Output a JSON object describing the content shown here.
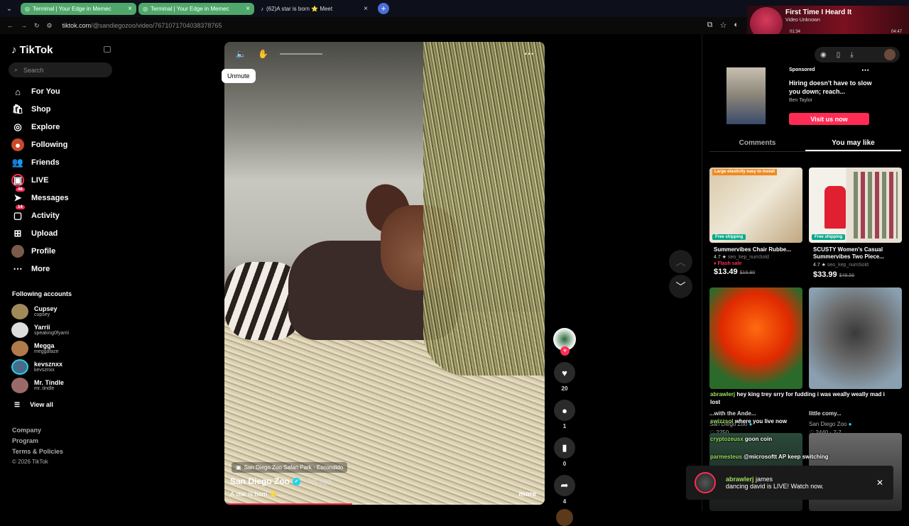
{
  "browser": {
    "tabs": [
      {
        "title": "Terminal | Your Edge in Memec"
      },
      {
        "title": "Terminal | Your Edge in Memec"
      },
      {
        "title": "(62)A star is born ⭐ Meet"
      }
    ],
    "url_host": "tiktok.com",
    "url_path": "/@sandiegozoo/video/7671071704038378765"
  },
  "media": {
    "title": "First Time I Heard It",
    "subtitle": "Video Unknown",
    "elapsed": "01:34",
    "duration": "04:47"
  },
  "sidebar": {
    "logo": "TikTok",
    "search_placeholder": "Search",
    "nav": [
      {
        "label": "For You",
        "icon": "home-icon"
      },
      {
        "label": "Shop",
        "icon": "shop-icon"
      },
      {
        "label": "Explore",
        "icon": "compass-icon"
      },
      {
        "label": "Following",
        "icon": "following-icon"
      },
      {
        "label": "Friends",
        "icon": "friends-icon"
      },
      {
        "label": "LIVE",
        "icon": "live-icon"
      },
      {
        "label": "Messages",
        "icon": "messages-icon",
        "badge": "48"
      },
      {
        "label": "Activity",
        "icon": "activity-icon",
        "badge": "14"
      },
      {
        "label": "Upload",
        "icon": "upload-icon"
      },
      {
        "label": "Profile",
        "icon": "profile-icon"
      },
      {
        "label": "More",
        "icon": "more-icon"
      }
    ],
    "following_title": "Following accounts",
    "accounts": [
      {
        "name": "Cupsey",
        "handle": "cupsey"
      },
      {
        "name": "Yarrii",
        "handle": "speaking0fyarrii"
      },
      {
        "name": "Megga",
        "handle": "meggafaze"
      },
      {
        "name": "kevsznxx",
        "handle": "kevsznxx"
      },
      {
        "name": "Mr. Tindle",
        "handle": "mr..tindle"
      }
    ],
    "view_all": "View all",
    "footer": [
      "Company",
      "Program",
      "Terms & Policies",
      "© 2026 TikTok"
    ]
  },
  "video": {
    "unmute_tip": "Unmute",
    "location": "San Diego Zoo Safari Park - Escondido",
    "author": "San Diego Zoo",
    "time_ago": "· 2m ago",
    "caption": "A star is born ⭐ ...",
    "more": "more",
    "progress": 0.4,
    "likes": "20",
    "comments": "1",
    "saves": "0",
    "shares": "4"
  },
  "right_panel": {
    "ad": {
      "sponsored": "Sponsored",
      "title": "Hiring doesn't have to slow you down; reach...",
      "author": "Ben Taylor",
      "cta": "Visit us now"
    },
    "tabs": [
      "Comments",
      "You may like"
    ],
    "products": [
      {
        "name": "Summervibes Chair Rubbe...",
        "rating": "4.7",
        "sold": "seo_kep_numSold",
        "flash": "Flash sale",
        "price": "$13.49",
        "old_price": "$16.90",
        "shipping": "Free shipping",
        "tag": "Large elasticity easy to install"
      },
      {
        "name": "SCUSTY Women's Casual Summervibes Two Piece...",
        "rating": "4.7",
        "sold": "seo_kep_numSold",
        "price": "$33.99",
        "old_price": "$48.56",
        "shipping": "Free shipping"
      }
    ],
    "videos": [
      {
        "title": "...with the Ande...",
        "author": "San Diego Zoo",
        "stats": "2250"
      },
      {
        "title": "little comy...",
        "author": "San Diego Zoo",
        "stats": "2440 · 7-7"
      }
    ],
    "chat": [
      {
        "name": "abrawlerj",
        "msg": "hey king trey srry for fudding i was weally weally mad i lost"
      },
      {
        "name": "swizzsol",
        "msg": "where you live now"
      },
      {
        "name": "cryptozeusx",
        "msg": "goon coin"
      },
      {
        "name": "parmesteus",
        "msg": "@microsoftt AP keep switching"
      }
    ],
    "toast": {
      "name": "abrawlerj",
      "msg1": "james",
      "msg2": "dancing david is LIVE! Watch now."
    }
  }
}
